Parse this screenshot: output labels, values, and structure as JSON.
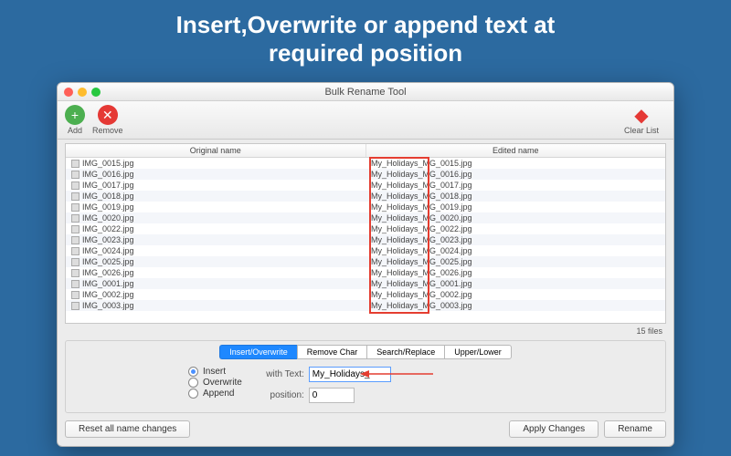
{
  "hero": {
    "line1": "Insert,Overwrite or append text at",
    "line2": "required position"
  },
  "window": {
    "title": "Bulk Rename Tool",
    "toolbar": {
      "add": "Add",
      "remove": "Remove",
      "clearList": "Clear List"
    },
    "columns": {
      "original": "Original name",
      "edited": "Edited name"
    },
    "files": [
      {
        "orig": "IMG_0015.jpg",
        "prefix": "My_Holidays_",
        "rest": "MG_0015.jpg"
      },
      {
        "orig": "IMG_0016.jpg",
        "prefix": "My_Holidays_",
        "rest": "MG_0016.jpg"
      },
      {
        "orig": "IMG_0017.jpg",
        "prefix": "My_Holidays_",
        "rest": "MG_0017.jpg"
      },
      {
        "orig": "IMG_0018.jpg",
        "prefix": "My_Holidays_",
        "rest": "MG_0018.jpg"
      },
      {
        "orig": "IMG_0019.jpg",
        "prefix": "My_Holidays_",
        "rest": "MG_0019.jpg"
      },
      {
        "orig": "IMG_0020.jpg",
        "prefix": "My_Holidays_",
        "rest": "MG_0020.jpg"
      },
      {
        "orig": "IMG_0022.jpg",
        "prefix": "My_Holidays_",
        "rest": "MG_0022.jpg"
      },
      {
        "orig": "IMG_0023.jpg",
        "prefix": "My_Holidays_",
        "rest": "MG_0023.jpg"
      },
      {
        "orig": "IMG_0024.jpg",
        "prefix": "My_Holidays_",
        "rest": "MG_0024.jpg"
      },
      {
        "orig": "IMG_0025.jpg",
        "prefix": "My_Holidays_",
        "rest": "MG_0025.jpg"
      },
      {
        "orig": "IMG_0026.jpg",
        "prefix": "My_Holidays_",
        "rest": "MG_0026.jpg"
      },
      {
        "orig": "IMG_0001.jpg",
        "prefix": "My_Holidays_",
        "rest": "MG_0001.jpg"
      },
      {
        "orig": "IMG_0002.jpg",
        "prefix": "My_Holidays_",
        "rest": "MG_0002.jpg"
      },
      {
        "orig": "IMG_0003.jpg",
        "prefix": "My_Holidays_",
        "rest": "MG_0003.jpg"
      }
    ],
    "fileCount": "15 files",
    "tabs": {
      "insert": "Insert/Overwrite",
      "removeChar": "Remove Char",
      "searchReplace": "Search/Replace",
      "upperLower": "Upper/Lower"
    },
    "mode": {
      "insert": "Insert",
      "overwrite": "Overwrite",
      "append": "Append",
      "selected": "insert"
    },
    "fields": {
      "withTextLabel": "with Text:",
      "withTextValue": "My_Holidays_",
      "positionLabel": "position:",
      "positionValue": "0"
    },
    "buttons": {
      "reset": "Reset all name changes",
      "apply": "Apply Changes",
      "rename": "Rename"
    }
  }
}
